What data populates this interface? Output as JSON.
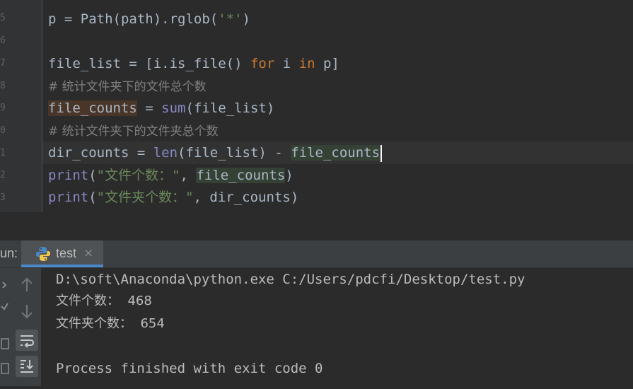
{
  "editor": {
    "gutter_fragments": [
      "5",
      "6",
      "7",
      "8",
      "9",
      "0",
      "1",
      "2",
      "3"
    ],
    "code_lines": [
      "p = Path(path).rglob('*')",
      "",
      "file_list = [i.is_file() for i in p]",
      "# 统计文件夹下的文件总个数",
      "file_counts = sum(file_list)",
      "# 统计文件夹下的文件夹总个数",
      "dir_counts = len(file_list) - file_counts",
      "print(\"文件个数：\", file_counts)",
      "print(\"文件夹个数：\", dir_counts)"
    ],
    "colors": {
      "background": "#2b2b2b",
      "keyword": "#cc7832",
      "string": "#6a8759",
      "builtin": "#8888c6",
      "comment": "#808080",
      "write_highlight": "#4a3629",
      "read_highlight": "#344134"
    }
  },
  "run_panel": {
    "label": "un:",
    "tab": {
      "title": "test",
      "close_glyph": "×",
      "icon": "python-icon"
    },
    "toolbar_icons": [
      "scroll-up-icon",
      "scroll-down-icon",
      "soft-wrap-icon",
      "scroll-to-end-icon"
    ],
    "output_lines": [
      "D:\\soft\\Anaconda\\python.exe C:/Users/pdcfi/Desktop/test.py",
      "文件个数：  468",
      "文件夹个数：  654",
      "",
      "Process finished with exit code 0"
    ]
  }
}
